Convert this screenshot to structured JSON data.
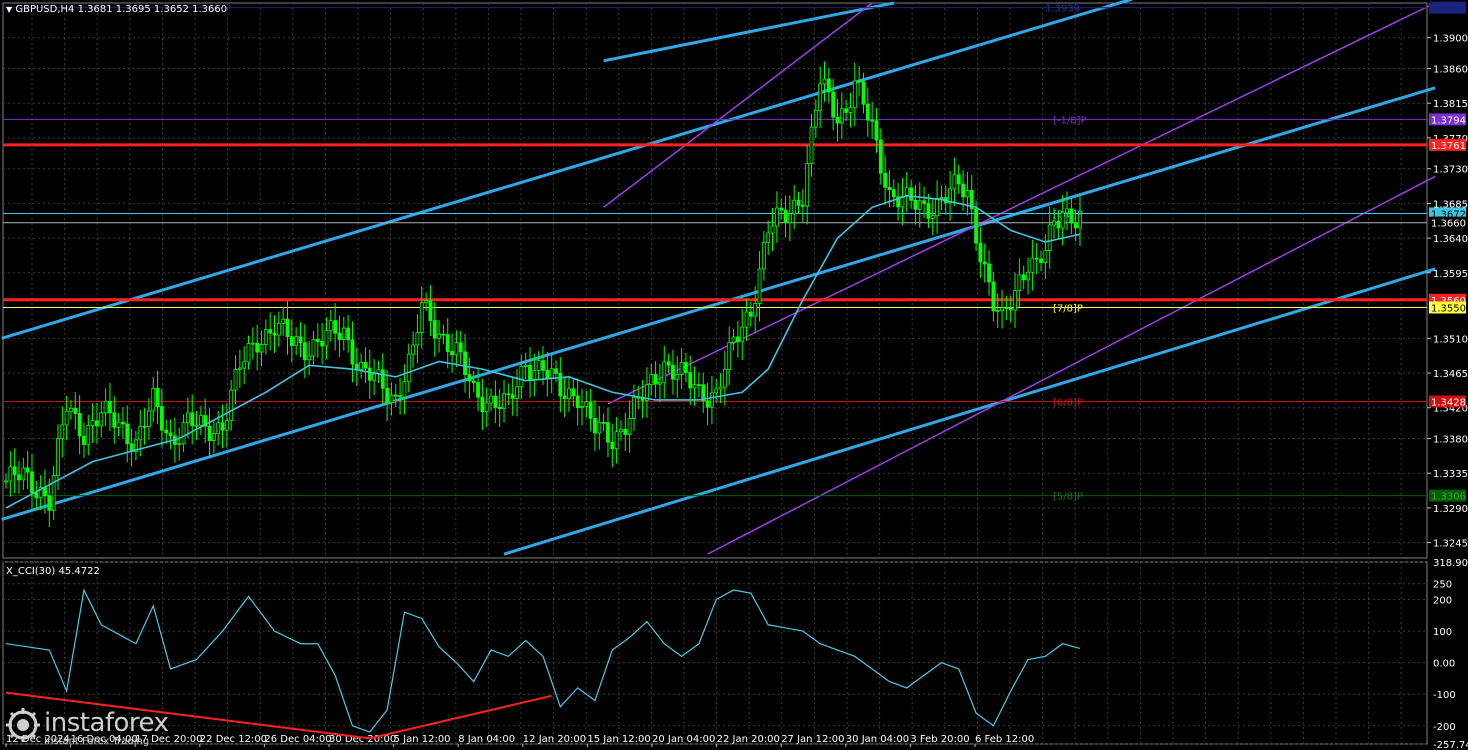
{
  "header": {
    "symbol_line": "GBPUSD,H4  1.3681 1.3695 1.3652 1.3660",
    "cci_line": "X_CCI(30) 45.4722"
  },
  "watermark": {
    "brand": "instaforex",
    "tagline": "Instant Forex Trading"
  },
  "colors": {
    "background": "#000000",
    "grid": "#3a3a3a",
    "candle": "#00ff00",
    "moving_average": "#3ec6e0",
    "channel": "#2fa8e8",
    "murray_diagonal": "#9b3fe8",
    "support_resistance": "#ff2020",
    "cci": "#4fc8e8",
    "cci_trendline": "#ff2020"
  },
  "chart_data": [
    {
      "type": "candlestick",
      "symbol": "GBPUSD",
      "timeframe": "H4",
      "ohlc_last": {
        "open": 1.3681,
        "high": 1.3695,
        "low": 1.3652,
        "close": 1.366
      },
      "ylim": [
        1.3225,
        1.3945
      ],
      "y_ticks": [
        "1.3900",
        "1.3860",
        "1.3815",
        "1.3770",
        "1.3730",
        "1.3685",
        "1.3640",
        "1.3595",
        "1.3510",
        "1.3465",
        "1.3420",
        "1.3380",
        "1.3335",
        "1.3290",
        "1.3245"
      ],
      "x_ticks": [
        "12 Dec 2024",
        "16 Dec 04:00",
        "17 Dec 20:00",
        "22 Dec 12:00",
        "26 Dec 04:00",
        "30 Dec 20:00",
        "5 Jan 12:00",
        "8 Jan 04:00",
        "12 Jan 20:00",
        "15 Jan 12:00",
        "20 Jan 04:00",
        "22 Jan 20:00",
        "27 Jan 12:00",
        "30 Jan 04:00",
        "3 Feb 20:00",
        "6 Feb 12:00"
      ],
      "close_path": [
        [
          0,
          1.3325
        ],
        [
          4,
          1.333
        ],
        [
          8,
          1.3315
        ],
        [
          10,
          1.33
        ],
        [
          14,
          1.342
        ],
        [
          18,
          1.339
        ],
        [
          22,
          1.341
        ],
        [
          26,
          1.34
        ],
        [
          30,
          1.3375
        ],
        [
          34,
          1.3425
        ],
        [
          38,
          1.338
        ],
        [
          42,
          1.34
        ],
        [
          46,
          1.339
        ],
        [
          50,
          1.34
        ],
        [
          54,
          1.347
        ],
        [
          58,
          1.351
        ],
        [
          62,
          1.3525
        ],
        [
          66,
          1.3505
        ],
        [
          70,
          1.35
        ],
        [
          74,
          1.351
        ],
        [
          78,
          1.352
        ],
        [
          82,
          1.347
        ],
        [
          86,
          1.345
        ],
        [
          88,
          1.344
        ],
        [
          90,
          1.3435
        ],
        [
          92,
          1.3465
        ],
        [
          94,
          1.349
        ],
        [
          96,
          1.355
        ],
        [
          100,
          1.352
        ],
        [
          104,
          1.349
        ],
        [
          108,
          1.344
        ],
        [
          112,
          1.343
        ],
        [
          116,
          1.342
        ],
        [
          120,
          1.348
        ],
        [
          124,
          1.347
        ],
        [
          128,
          1.344
        ],
        [
          132,
          1.344
        ],
        [
          136,
          1.339
        ],
        [
          140,
          1.338
        ],
        [
          144,
          1.341
        ],
        [
          148,
          1.344
        ],
        [
          152,
          1.348
        ],
        [
          156,
          1.346
        ],
        [
          160,
          1.344
        ],
        [
          164,
          1.344
        ],
        [
          168,
          1.35
        ],
        [
          172,
          1.355
        ],
        [
          176,
          1.365
        ],
        [
          180,
          1.367
        ],
        [
          184,
          1.37
        ],
        [
          188,
          1.384
        ],
        [
          190,
          1.382
        ],
        [
          192,
          1.38
        ],
        [
          194,
          1.381
        ],
        [
          196,
          1.384
        ],
        [
          198,
          1.381
        ],
        [
          200,
          1.378
        ],
        [
          202,
          1.374
        ],
        [
          204,
          1.37
        ],
        [
          208,
          1.3685
        ],
        [
          212,
          1.368
        ],
        [
          216,
          1.369
        ],
        [
          220,
          1.3705
        ],
        [
          222,
          1.37
        ],
        [
          224,
          1.365
        ],
        [
          226,
          1.36
        ],
        [
          228,
          1.355
        ],
        [
          230,
          1.353
        ],
        [
          232,
          1.356
        ],
        [
          234,
          1.359
        ],
        [
          236,
          1.361
        ],
        [
          238,
          1.36
        ],
        [
          240,
          1.362
        ],
        [
          242,
          1.366
        ],
        [
          244,
          1.368
        ],
        [
          246,
          1.367
        ],
        [
          248,
          1.366
        ]
      ],
      "moving_average_path": [
        [
          0,
          1.329
        ],
        [
          20,
          1.335
        ],
        [
          40,
          1.338
        ],
        [
          60,
          1.344
        ],
        [
          70,
          1.3475
        ],
        [
          80,
          1.347
        ],
        [
          90,
          1.346
        ],
        [
          100,
          1.348
        ],
        [
          110,
          1.347
        ],
        [
          120,
          1.3455
        ],
        [
          130,
          1.346
        ],
        [
          140,
          1.344
        ],
        [
          150,
          1.343
        ],
        [
          160,
          1.343
        ],
        [
          170,
          1.344
        ],
        [
          176,
          1.347
        ],
        [
          184,
          1.356
        ],
        [
          192,
          1.364
        ],
        [
          200,
          1.368
        ],
        [
          208,
          1.3695
        ],
        [
          216,
          1.369
        ],
        [
          224,
          1.368
        ],
        [
          232,
          1.365
        ],
        [
          240,
          1.3635
        ],
        [
          248,
          1.3645
        ]
      ],
      "horizontal_levels": [
        {
          "label": "1.3939",
          "price": 1.3939,
          "style": "blue-dark"
        },
        {
          "label": "[-1/8]P",
          "price": 1.3794,
          "style": "purple",
          "tag": "1.3794"
        },
        {
          "label": "",
          "price": 1.3761,
          "style": "red",
          "tag": "1.3761"
        },
        {
          "label": "[8/8]P",
          "price": 1.3672,
          "style": "cyan",
          "tag": "1.3672"
        },
        {
          "label": "",
          "price": 1.366,
          "style": "white",
          "tag": "1.3660"
        },
        {
          "label": "",
          "price": 1.356,
          "style": "red",
          "tag": "1.3560"
        },
        {
          "label": "[7/8]P",
          "price": 1.355,
          "style": "yellow",
          "tag": "1.3550"
        },
        {
          "label": "[6/8]P",
          "price": 1.3428,
          "style": "red-thin",
          "tag": "1.3428"
        },
        {
          "label": "[5/8]P",
          "price": 1.3306,
          "style": "green",
          "tag": "1.3306"
        }
      ]
    },
    {
      "type": "line",
      "name": "X_CCI(30)",
      "value": 45.4722,
      "ylim": [
        -257.742,
        318.904
      ],
      "y_ticks": [
        "318.904",
        "250",
        "200",
        "100",
        "0.00",
        "-100",
        "-200",
        "-257.742"
      ],
      "values_path": [
        [
          0,
          60
        ],
        [
          10,
          40
        ],
        [
          14,
          -90
        ],
        [
          18,
          230
        ],
        [
          22,
          120
        ],
        [
          30,
          60
        ],
        [
          34,
          180
        ],
        [
          38,
          -20
        ],
        [
          44,
          10
        ],
        [
          50,
          100
        ],
        [
          56,
          210
        ],
        [
          62,
          100
        ],
        [
          68,
          60
        ],
        [
          72,
          60
        ],
        [
          76,
          -40
        ],
        [
          80,
          -200
        ],
        [
          84,
          -220
        ],
        [
          88,
          -150
        ],
        [
          92,
          160
        ],
        [
          96,
          140
        ],
        [
          100,
          50
        ],
        [
          104,
          0
        ],
        [
          108,
          -60
        ],
        [
          112,
          40
        ],
        [
          116,
          20
        ],
        [
          120,
          70
        ],
        [
          124,
          20
        ],
        [
          128,
          -140
        ],
        [
          132,
          -80
        ],
        [
          136,
          -120
        ],
        [
          140,
          40
        ],
        [
          144,
          80
        ],
        [
          148,
          130
        ],
        [
          152,
          60
        ],
        [
          156,
          20
        ],
        [
          160,
          60
        ],
        [
          164,
          200
        ],
        [
          168,
          230
        ],
        [
          172,
          220
        ],
        [
          176,
          120
        ],
        [
          180,
          110
        ],
        [
          184,
          100
        ],
        [
          188,
          60
        ],
        [
          192,
          40
        ],
        [
          196,
          20
        ],
        [
          200,
          -20
        ],
        [
          204,
          -60
        ],
        [
          208,
          -80
        ],
        [
          212,
          -40
        ],
        [
          216,
          0
        ],
        [
          220,
          -20
        ],
        [
          224,
          -160
        ],
        [
          228,
          -200
        ],
        [
          232,
          -90
        ],
        [
          236,
          10
        ],
        [
          240,
          20
        ],
        [
          244,
          60
        ],
        [
          248,
          45
        ]
      ],
      "trendlines": [
        {
          "from": [
            0,
            -95
          ],
          "to": [
            84,
            -240
          ]
        },
        {
          "from": [
            84,
            -240
          ],
          "to": [
            126,
            -105
          ]
        }
      ]
    }
  ]
}
